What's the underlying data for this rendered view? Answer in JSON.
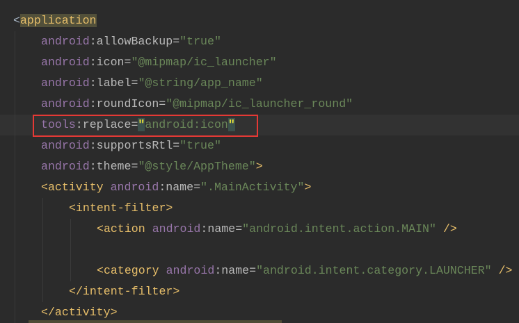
{
  "editor": {
    "lines": [
      {
        "indent": 0,
        "tokens": [
          [
            "br0",
            "<"
          ],
          [
            "tag hltag",
            "application"
          ]
        ]
      },
      {
        "indent": 1,
        "tokens": [
          [
            "ns",
            "android"
          ],
          [
            "attr",
            ":allowBackup="
          ],
          [
            "str",
            "\"true\""
          ]
        ]
      },
      {
        "indent": 1,
        "tokens": [
          [
            "ns",
            "android"
          ],
          [
            "attr",
            ":icon="
          ],
          [
            "str",
            "\"@mipmap/ic_launcher\""
          ]
        ]
      },
      {
        "indent": 1,
        "tokens": [
          [
            "ns",
            "android"
          ],
          [
            "attr",
            ":label="
          ],
          [
            "str",
            "\"@string/app_name\""
          ]
        ]
      },
      {
        "indent": 1,
        "tokens": [
          [
            "ns",
            "android"
          ],
          [
            "attr",
            ":roundIcon="
          ],
          [
            "str",
            "\"@mipmap/ic_launcher_round\""
          ]
        ]
      },
      {
        "indent": 1,
        "current": true,
        "tokens": [
          [
            "ns",
            "tools"
          ],
          [
            "attr",
            ":replace="
          ],
          [
            "hlq",
            "\""
          ],
          [
            "str",
            "android:icon"
          ],
          [
            "hlq",
            "\""
          ]
        ]
      },
      {
        "indent": 1,
        "tokens": [
          [
            "ns",
            "android"
          ],
          [
            "attr",
            ":supportsRtl="
          ],
          [
            "str",
            "\"true\""
          ]
        ]
      },
      {
        "indent": 1,
        "tokens": [
          [
            "ns",
            "android"
          ],
          [
            "attr",
            ":theme="
          ],
          [
            "str",
            "\"@style/AppTheme\""
          ],
          [
            "br",
            ">"
          ]
        ]
      },
      {
        "indent": 1,
        "tokens": [
          [
            "br",
            "<"
          ],
          [
            "tag",
            "activity "
          ],
          [
            "ns",
            "android"
          ],
          [
            "attr",
            ":name="
          ],
          [
            "str",
            "\".MainActivity\""
          ],
          [
            "br",
            ">"
          ]
        ]
      },
      {
        "indent": 2,
        "tokens": [
          [
            "br",
            "<"
          ],
          [
            "tag",
            "intent-filter"
          ],
          [
            "br",
            ">"
          ]
        ]
      },
      {
        "indent": 3,
        "tokens": [
          [
            "br",
            "<"
          ],
          [
            "tag",
            "action "
          ],
          [
            "ns",
            "android"
          ],
          [
            "attr",
            ":name="
          ],
          [
            "str",
            "\"android.intent.action.MAIN\""
          ],
          [
            "br",
            " />"
          ]
        ]
      },
      {
        "indent": 3,
        "tokens": []
      },
      {
        "indent": 3,
        "tokens": [
          [
            "br",
            "<"
          ],
          [
            "tag",
            "category "
          ],
          [
            "ns",
            "android"
          ],
          [
            "attr",
            ":name="
          ],
          [
            "str",
            "\"android.intent.category.LAUNCHER\""
          ],
          [
            "br",
            " />"
          ]
        ]
      },
      {
        "indent": 2,
        "tokens": [
          [
            "br",
            "</"
          ],
          [
            "tag",
            "intent-filter"
          ],
          [
            "br",
            ">"
          ]
        ]
      },
      {
        "indent": 1,
        "tokens": [
          [
            "br",
            "</"
          ],
          [
            "tag",
            "activity"
          ],
          [
            "br",
            ">"
          ]
        ]
      }
    ]
  }
}
